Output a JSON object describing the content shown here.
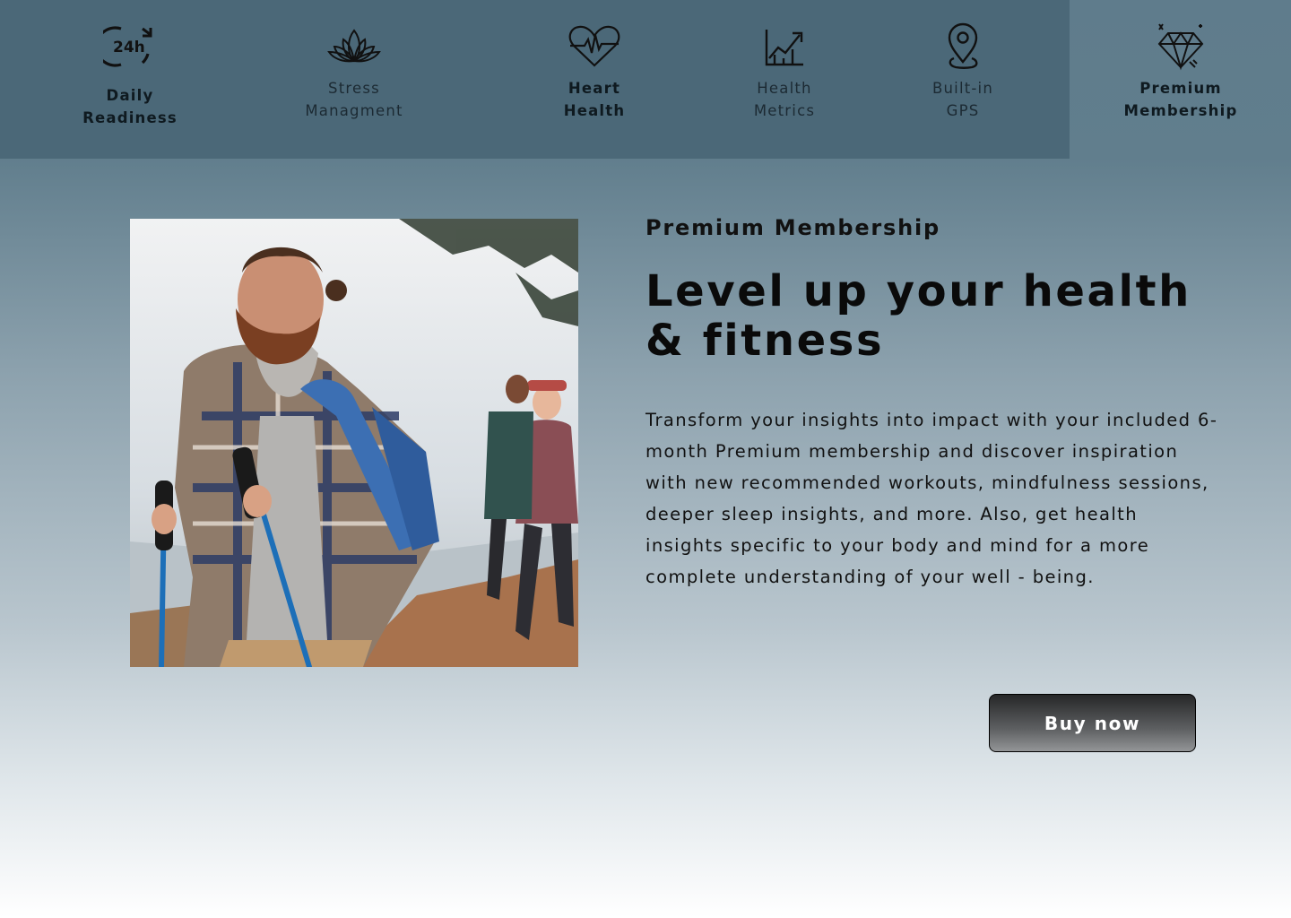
{
  "features": [
    {
      "label": "Daily\nReadiness",
      "icon": "24h-icon"
    },
    {
      "label": "Stress\nManagment",
      "icon": "lotus-icon"
    },
    {
      "label": "Heart\nHealth",
      "icon": "heart-pulse-icon"
    },
    {
      "label": "Health\nMetrics",
      "icon": "trend-chart-icon"
    },
    {
      "label": "Built-in\nGPS",
      "icon": "location-pin-icon"
    },
    {
      "label": "Premium\nMembership",
      "icon": "diamond-icon"
    }
  ],
  "icon_24h_text": "24h",
  "section": {
    "eyebrow": "Premium Membership",
    "headline": "Level up your health & fitness",
    "body": "Transform your insights into impact with your included 6-month Premium membership and discover inspiration with new recommended workouts, mindfulness sessions, deeper sleep insights, and more. Also, get health insights specific to your body and mind for a more complete understanding of your well - being.",
    "button_label": "Buy now"
  },
  "colors": {
    "nav_bg": "#4b6878",
    "button_top": "#262728",
    "button_bottom": "#939597"
  }
}
